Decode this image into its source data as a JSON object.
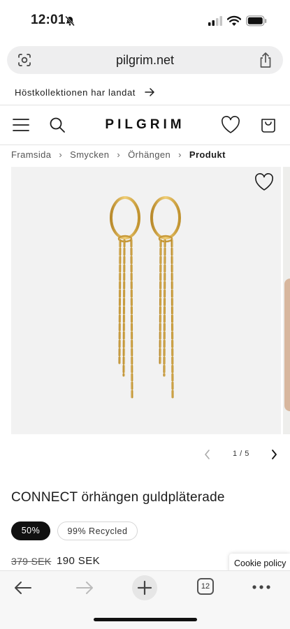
{
  "status_bar": {
    "time": "12:01"
  },
  "browser": {
    "url": "pilgrim.net",
    "tab_count": "12"
  },
  "promo": {
    "text": "Höstkollektionen har landat"
  },
  "header": {
    "logo": "PILGRIM"
  },
  "breadcrumb": [
    {
      "label": "Framsida"
    },
    {
      "label": "Smycken"
    },
    {
      "label": "Örhängen"
    },
    {
      "label": "Produkt"
    }
  ],
  "gallery": {
    "page_indicator": "1 / 5"
  },
  "product": {
    "title": "CONNECT örhängen guldpläterade",
    "badges": {
      "sale": "50%",
      "recycled": "99% Recycled"
    },
    "old_price": "379 SEK",
    "new_price": "190 SEK"
  },
  "cookie": {
    "label": "Cookie policy"
  },
  "icons": {
    "lens": "lens-icon",
    "share": "share-icon",
    "menu": "hamburger-icon",
    "search": "search-icon",
    "wishlist": "heart-icon",
    "bag": "bag-icon",
    "arrow": "arrow-right-icon",
    "back": "back-arrow-icon",
    "forward": "forward-arrow-icon",
    "new_tab": "plus-icon",
    "more": "more-icon"
  },
  "colors": {
    "gold": "#d9b04a",
    "text": "#1c1c1c",
    "badge_dark": "#111111"
  }
}
